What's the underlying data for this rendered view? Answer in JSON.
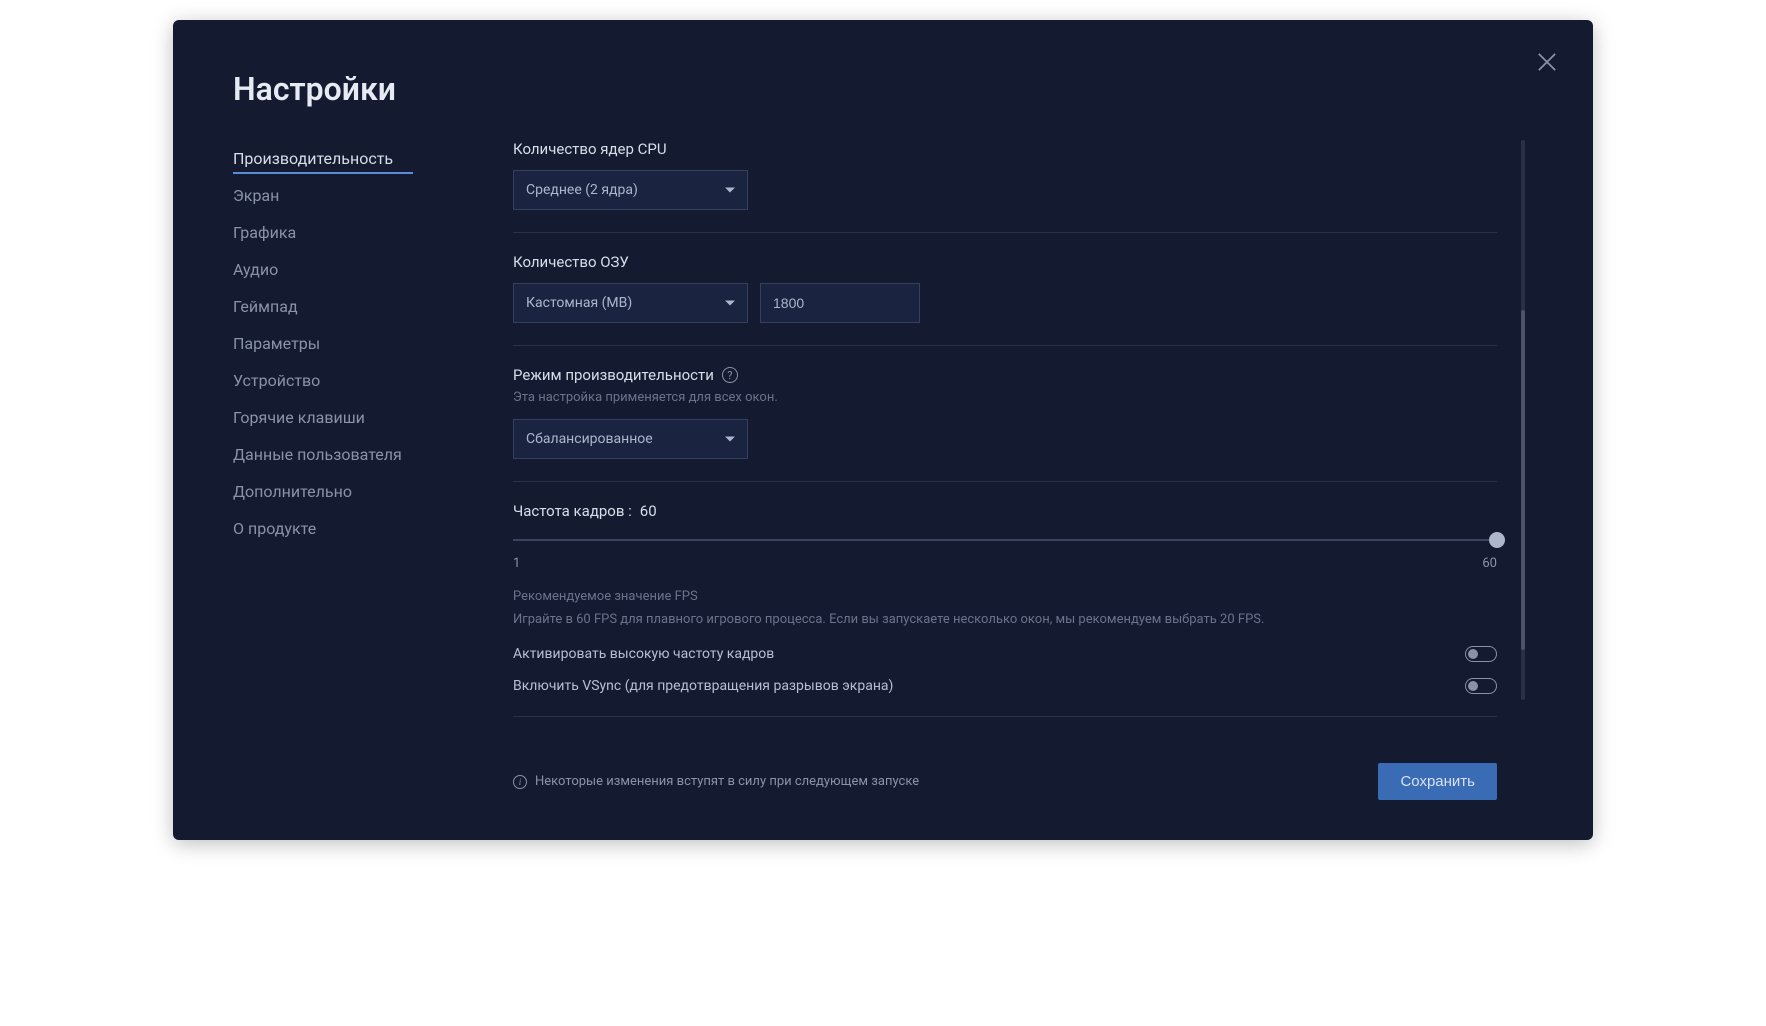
{
  "title": "Настройки",
  "sidebar": {
    "items": [
      {
        "label": "Производительность",
        "active": true
      },
      {
        "label": "Экран",
        "active": false
      },
      {
        "label": "Графика",
        "active": false
      },
      {
        "label": "Аудио",
        "active": false
      },
      {
        "label": "Геймпад",
        "active": false
      },
      {
        "label": "Параметры",
        "active": false
      },
      {
        "label": "Устройство",
        "active": false
      },
      {
        "label": "Горячие клавиши",
        "active": false
      },
      {
        "label": "Данные пользователя",
        "active": false
      },
      {
        "label": "Дополнительно",
        "active": false
      },
      {
        "label": "О продукте",
        "active": false
      }
    ]
  },
  "cpu": {
    "label": "Количество ядер CPU",
    "value": "Среднее (2 ядра)"
  },
  "ram": {
    "label": "Количество ОЗУ",
    "mode": "Кастомная (MB)",
    "value": "1800"
  },
  "perf_mode": {
    "label": "Режим производительности",
    "sub": "Эта настройка применяется для всех окон.",
    "value": "Сбалансированное"
  },
  "fps": {
    "label_prefix": "Частота кадров : ",
    "value": "60",
    "min": "1",
    "max": "60",
    "hint_title": "Рекомендуемое значение FPS",
    "hint_text": "Играйте в 60 FPS для плавного игрового процесса. Если вы запускаете несколько окон, мы рекомендуем выбрать 20 FPS."
  },
  "toggles": {
    "high_fps": {
      "label": "Активировать высокую частоту кадров",
      "on": false
    },
    "vsync": {
      "label": "Включить VSync (для предотвращения разрывов экрана)",
      "on": false
    }
  },
  "footer": {
    "note": "Некоторые изменения вступят в силу при следующем запуске",
    "save": "Сохранить"
  }
}
